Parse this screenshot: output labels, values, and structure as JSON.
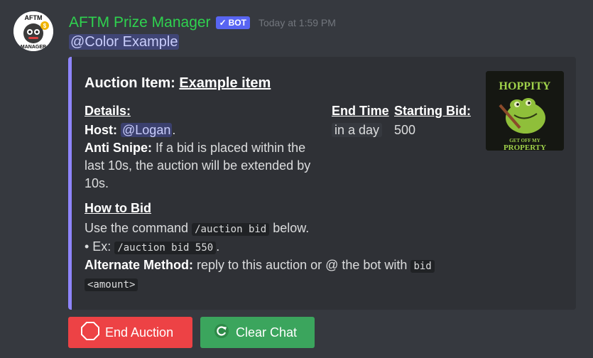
{
  "message": {
    "username": "AFTM Prize Manager",
    "bot_tag": "BOT",
    "bot_check": "✓",
    "timestamp": "Today at 1:59 PM",
    "mention": "@Color Example",
    "avatar_text_top": "AFTM",
    "avatar_text_bottom": "MANAGER"
  },
  "embed": {
    "accent_color": "#8f85ff",
    "title_prefix": "Auction Item:",
    "title_link": "Example item",
    "details_heading": "Details:",
    "host_label": "Host:",
    "host_mention": "@Logan",
    "host_suffix": ".",
    "anti_snipe_label": "Anti Snipe:",
    "anti_snipe_text_1": "If a bid is placed within the",
    "anti_snipe_text_2": "last 10s, the auction will be extended by",
    "anti_snipe_text_3": "10s.",
    "end_time_heading": "End Time",
    "end_time_value": "in a day",
    "starting_bid_heading": "Starting Bid:",
    "starting_bid_value": "500",
    "how_to_heading": "How to Bid",
    "use_command_prefix": "Use the command",
    "use_command_code": "/auction bid",
    "use_command_suffix": "below.",
    "example_prefix": "• Ex:",
    "example_code": "/auction bid 550",
    "example_suffix": ".",
    "alt_label": "Alternate Method:",
    "alt_text": "reply to this auction or @ the bot with",
    "alt_code_1": "bid",
    "alt_code_2": "<amount>",
    "thumbnail_title": "HOPPITY",
    "thumbnail_caption": "GET OFF MY",
    "thumbnail_caption_2": "PROPERTY"
  },
  "buttons": {
    "end_auction": "End Auction",
    "clear_chat": "Clear Chat"
  },
  "colors": {
    "username": "#2fd24f",
    "bot_tag": "#5865f2",
    "danger": "#ed4245",
    "success": "#3ba55d"
  }
}
